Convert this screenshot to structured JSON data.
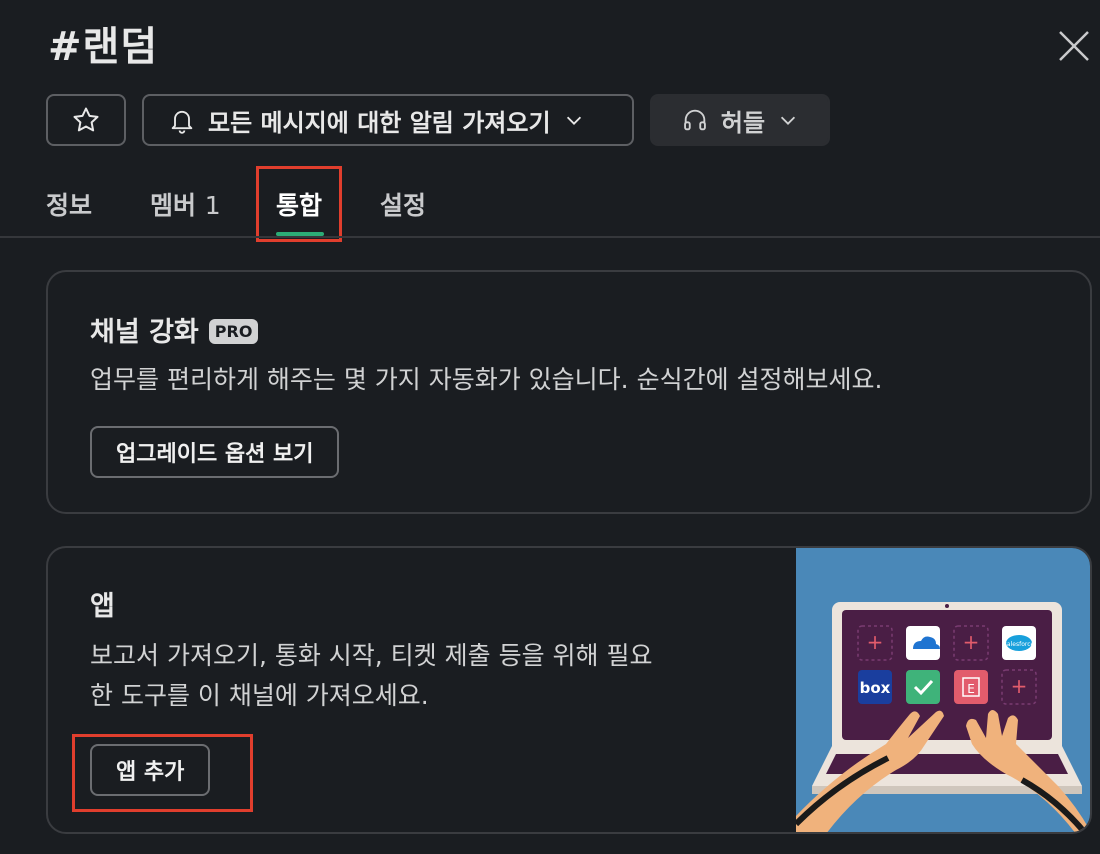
{
  "header": {
    "title": "#랜덤"
  },
  "toolbar": {
    "notifications_label": "모든 메시지에 대한 알림 가져오기",
    "huddle_label": "허들"
  },
  "tabs": [
    {
      "label": "정보"
    },
    {
      "label": "멤버",
      "count": "1"
    },
    {
      "label": "통합"
    },
    {
      "label": "설정"
    }
  ],
  "enhance_card": {
    "title": "채널 강화",
    "badge": "PRO",
    "description": "업무를 편리하게 해주는 몇 가지 자동화가 있습니다. 순식간에 설정해보세요.",
    "button_label": "업그레이드 옵션 보기"
  },
  "apps_card": {
    "title": "앱",
    "description_line1": "보고서 가져오기, 통화 시작, 티켓 제출 등을 위해 필요",
    "description_line2": "한 도구를 이 채널에 가져오세요.",
    "button_label": "앱 추가",
    "illustration": {
      "box_label": "box",
      "salesforce_label": "salesforce",
      "evernote_label": "E"
    }
  },
  "colors": {
    "background": "#1a1d21",
    "accent_tab": "#2bac76",
    "highlight": "#e03e2d",
    "illustration_bg": "#4a88b8"
  }
}
